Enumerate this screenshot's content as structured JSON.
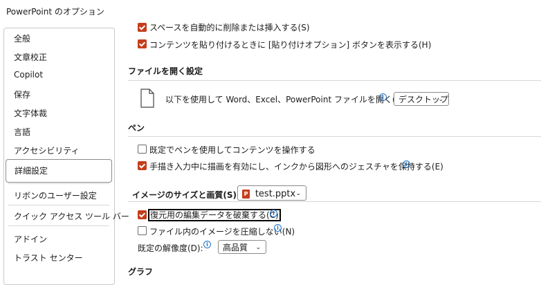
{
  "window": {
    "title": "PowerPoint のオプション"
  },
  "sidebar": {
    "items": [
      "全般",
      "文章校正",
      "Copilot",
      "保存",
      "文字体裁",
      "言語",
      "アクセシビリティ",
      "詳細設定",
      "リボンのユーザー設定",
      "クイック アクセス ツール バー",
      "アドイン",
      "トラスト センター"
    ],
    "selected": "詳細設定"
  },
  "edit": {
    "smart_space": {
      "label": "スペースを自動的に削除または挿入する(S)",
      "checked": true
    },
    "paste_options": {
      "label": "コンテンツを貼り付けるときに [貼り付けオプション] ボタンを表示する(H)",
      "checked": true
    }
  },
  "file_open": {
    "heading": "ファイルを開く設定",
    "label": "以下を使用して Word、Excel、PowerPoint ファイルを開く(P):",
    "value": "デスクトップ"
  },
  "pen": {
    "heading": "ペン",
    "use_pen": {
      "label": "既定でペンを使用してコンテンツを操作する",
      "checked": false
    },
    "ink_gestures": {
      "label": "手描き入力中に描画を有効にし、インクから図形へのジェスチャを保持する(E)",
      "checked": true
    }
  },
  "image": {
    "heading": "イメージのサイズと画質(S)",
    "file": "test.pptx",
    "discard": {
      "label": "復元用の編集データを破棄する(C)",
      "checked": true
    },
    "no_compress": {
      "label": "ファイル内のイメージを圧縮しない(N)",
      "checked": false
    },
    "resolution_label": "既定の解像度(D):",
    "resolution": "高品質"
  },
  "chart": {
    "heading": "グラフ"
  },
  "colors": {
    "accent": "#c43e1c",
    "info": "#1a73c8"
  }
}
